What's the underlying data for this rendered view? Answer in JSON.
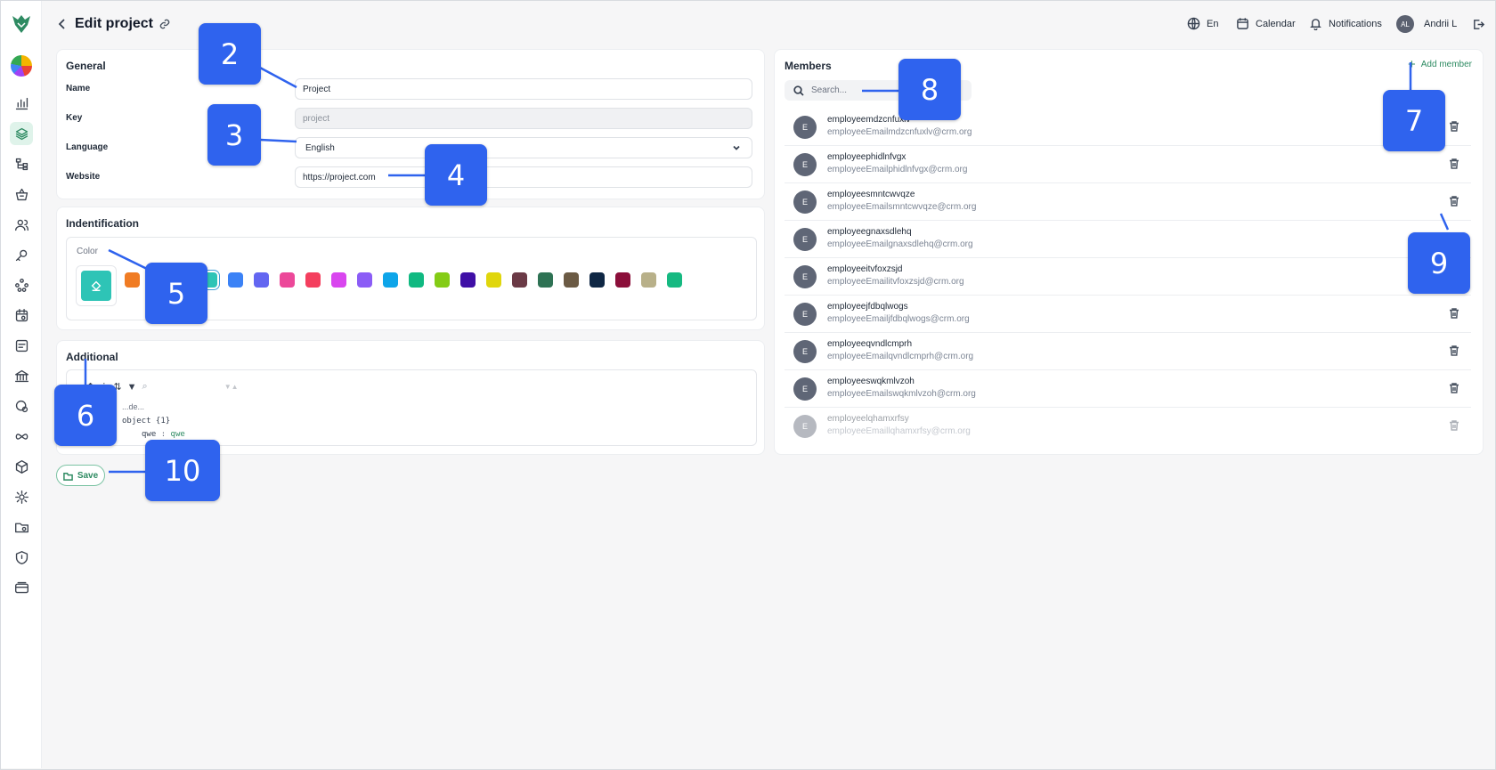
{
  "header": {
    "title": "Edit project",
    "language": "En",
    "calendar": "Calendar",
    "notifications": "Notifications",
    "user_initials": "AL",
    "user_name": "Andrii L"
  },
  "sidebar": {
    "items": [
      "analytics-icon",
      "projects-icon",
      "hierarchy-icon",
      "basket-icon",
      "users-icon",
      "key-icon",
      "structure-icon",
      "calendar-settings-icon",
      "notes-icon",
      "bank-icon",
      "finance-icon",
      "infinity-icon",
      "box-icon",
      "settings-icon",
      "folder-settings-icon",
      "shield-icon",
      "wallet-icon"
    ],
    "active": "projects-icon"
  },
  "general": {
    "title": "General",
    "name_label": "Name",
    "name_value": "Project",
    "key_label": "Key",
    "key_value": "project",
    "language_label": "Language",
    "language_value": "English",
    "website_label": "Website",
    "website_value": "https://project.com"
  },
  "identification": {
    "title": "Indentification",
    "color_label": "Color",
    "selected_color": "#2ec4b6",
    "swatches": [
      "#f07c24",
      "#f6b7a9",
      "#f2d13a",
      "#2ec4b6",
      "#3b82f6",
      "#6366f1",
      "#ec4899",
      "#f43f5e",
      "#d946ef",
      "#8b5cf6",
      "#0ea5e9",
      "#10b981",
      "#84cc16",
      "#3f0fa6",
      "#e0d60c",
      "#6b3a46",
      "#2e7254",
      "#6b5a44",
      "#0f2744",
      "#8b0f3a",
      "#b8b089",
      "#16b981"
    ]
  },
  "additional": {
    "title": "Additional",
    "toolbar_icons": [
      "expand-icon",
      "collapse-icon",
      "sort-icon",
      "filter-icon",
      "search-icon",
      "undo-icon",
      "redo-icon"
    ],
    "code_label": "...de...",
    "object_line": "object {1}",
    "entry_key": "qwe",
    "entry_value": "qwe"
  },
  "save_label": "Save",
  "members": {
    "title": "Members",
    "add_label": "Add member",
    "search_placeholder": "Search...",
    "list": [
      {
        "initial": "E",
        "name": "employeemdzcnfuxlv",
        "email": "employeeEmailmdzcnfuxlv@crm.org"
      },
      {
        "initial": "E",
        "name": "employeephidlnfvgx",
        "email": "employeeEmailphidlnfvgx@crm.org"
      },
      {
        "initial": "E",
        "name": "employeesmntcwvqze",
        "email": "employeeEmailsmntcwvqze@crm.org"
      },
      {
        "initial": "E",
        "name": "employeegnaxsdlehq",
        "email": "employeeEmailgnaxsdlehq@crm.org"
      },
      {
        "initial": "E",
        "name": "employeeitvfoxzsjd",
        "email": "employeeEmailitvfoxzsjd@crm.org"
      },
      {
        "initial": "E",
        "name": "employeejfdbqlwogs",
        "email": "employeeEmailjfdbqlwogs@crm.org"
      },
      {
        "initial": "E",
        "name": "employeeqvndlcmprh",
        "email": "employeeEmailqvndlcmprh@crm.org"
      },
      {
        "initial": "E",
        "name": "employeeswqkmlvzoh",
        "email": "employeeEmailswqkmlvzoh@crm.org"
      },
      {
        "initial": "E",
        "name": "employeelqhamxrfsy",
        "email": "employeeEmaillqhamxrfsy@crm.org"
      }
    ]
  },
  "callouts": [
    "2",
    "3",
    "4",
    "5",
    "6",
    "7",
    "8",
    "9",
    "10"
  ]
}
